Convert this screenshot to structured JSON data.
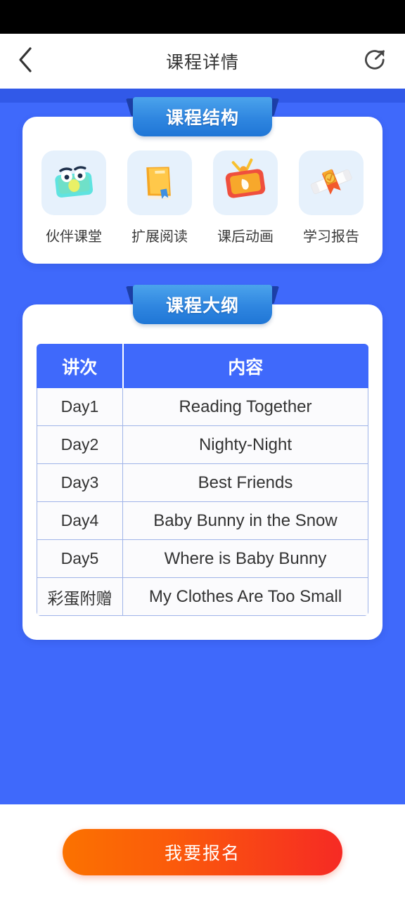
{
  "header": {
    "title": "课程详情",
    "back_icon": "chevron-left-icon",
    "share_icon": "share-circle-icon"
  },
  "structure_section": {
    "banner_title": "课程结构",
    "items": [
      {
        "label": "伙伴课堂",
        "icon": "laptop-character-icon"
      },
      {
        "label": "扩展阅读",
        "icon": "book-icon"
      },
      {
        "label": "课后动画",
        "icon": "tv-play-icon"
      },
      {
        "label": "学习报告",
        "icon": "diploma-scroll-icon"
      }
    ]
  },
  "outline_section": {
    "banner_title": "课程大纲",
    "table": {
      "headers": [
        "讲次",
        "内容"
      ],
      "rows": [
        {
          "day": "Day1",
          "content": "Reading Together"
        },
        {
          "day": "Day2",
          "content": "Nighty-Night"
        },
        {
          "day": "Day3",
          "content": "Best Friends"
        },
        {
          "day": "Day4",
          "content": "Baby Bunny in the Snow"
        },
        {
          "day": "Day5",
          "content": "Where is Baby Bunny"
        },
        {
          "day": "彩蛋附赠",
          "content": "My Clothes Are Too Small"
        }
      ]
    }
  },
  "footer": {
    "cta_label": "我要报名"
  },
  "colors": {
    "background_blue": "#3f69fb",
    "background_blue_dark": "#3159e8",
    "banner_blue": "#2f86e0",
    "banner_flap": "#1d3fa8",
    "cta_gradient_start": "#fb7200",
    "cta_gradient_end": "#f62a24",
    "icon_tile": "#e6f1fc",
    "table_border": "#9fb3e8"
  }
}
